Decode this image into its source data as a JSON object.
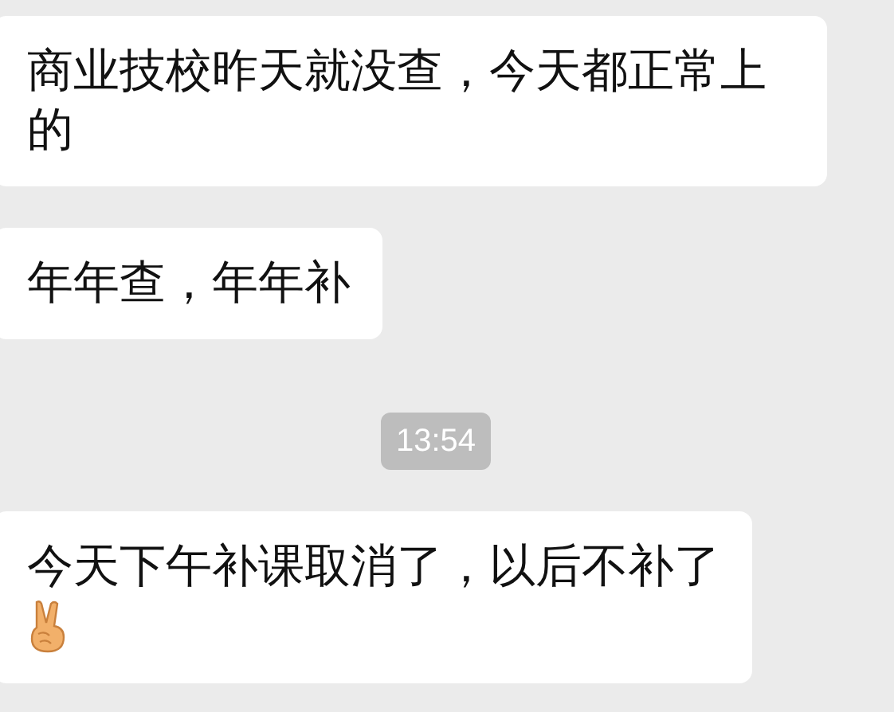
{
  "messages": [
    {
      "kind": "text",
      "text": "商业技校昨天就没查，今天都正常上的",
      "emoji": false
    },
    {
      "kind": "text",
      "text": "年年查，年年补",
      "emoji": false
    },
    {
      "kind": "time",
      "text": "13:54"
    },
    {
      "kind": "text",
      "text": "今天下午补课取消了，以后不补了",
      "emoji": true
    }
  ]
}
